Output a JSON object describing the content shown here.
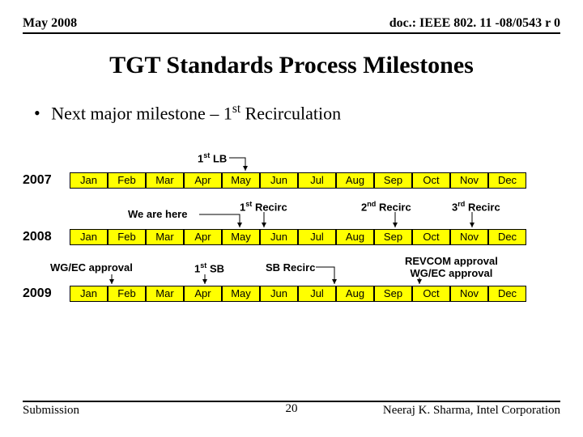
{
  "header": {
    "left": "May 2008",
    "right": "doc.: IEEE 802. 11 -08/0543 r 0"
  },
  "title": "TGT  Standards Process Milestones",
  "bullet": {
    "dot": "•",
    "prefix": "Next major milestone – 1",
    "sup": "st",
    "suffix": " Recirculation"
  },
  "chart_data": {
    "type": "table",
    "years": [
      "2007",
      "2008",
      "2009"
    ],
    "months": [
      "Jan",
      "Feb",
      "Mar",
      "Apr",
      "May",
      "Jun",
      "Jul",
      "Aug",
      "Sep",
      "Oct",
      "Nov",
      "Dec"
    ],
    "annotations": {
      "lb1": {
        "pre": "1",
        "sup": "st",
        "post": " LB"
      },
      "we_here": "We are here",
      "recirc1": {
        "pre": "1",
        "sup": "st",
        "post": " Recirc"
      },
      "recirc2": {
        "pre": "2",
        "sup": "nd",
        "post": " Recirc"
      },
      "recirc3": {
        "pre": "3",
        "sup": "rd",
        "post": " Recirc"
      },
      "wgec": "WG/EC approval",
      "sb1": {
        "pre": "1",
        "sup": "st",
        "post": " SB"
      },
      "sbrec": "SB Recirc",
      "revcom": "REVCOM approval",
      "wgec2": "WG/EC approval"
    }
  },
  "footer": {
    "left": "Submission",
    "page": "20",
    "right": "Neeraj K. Sharma, Intel Corporation"
  }
}
